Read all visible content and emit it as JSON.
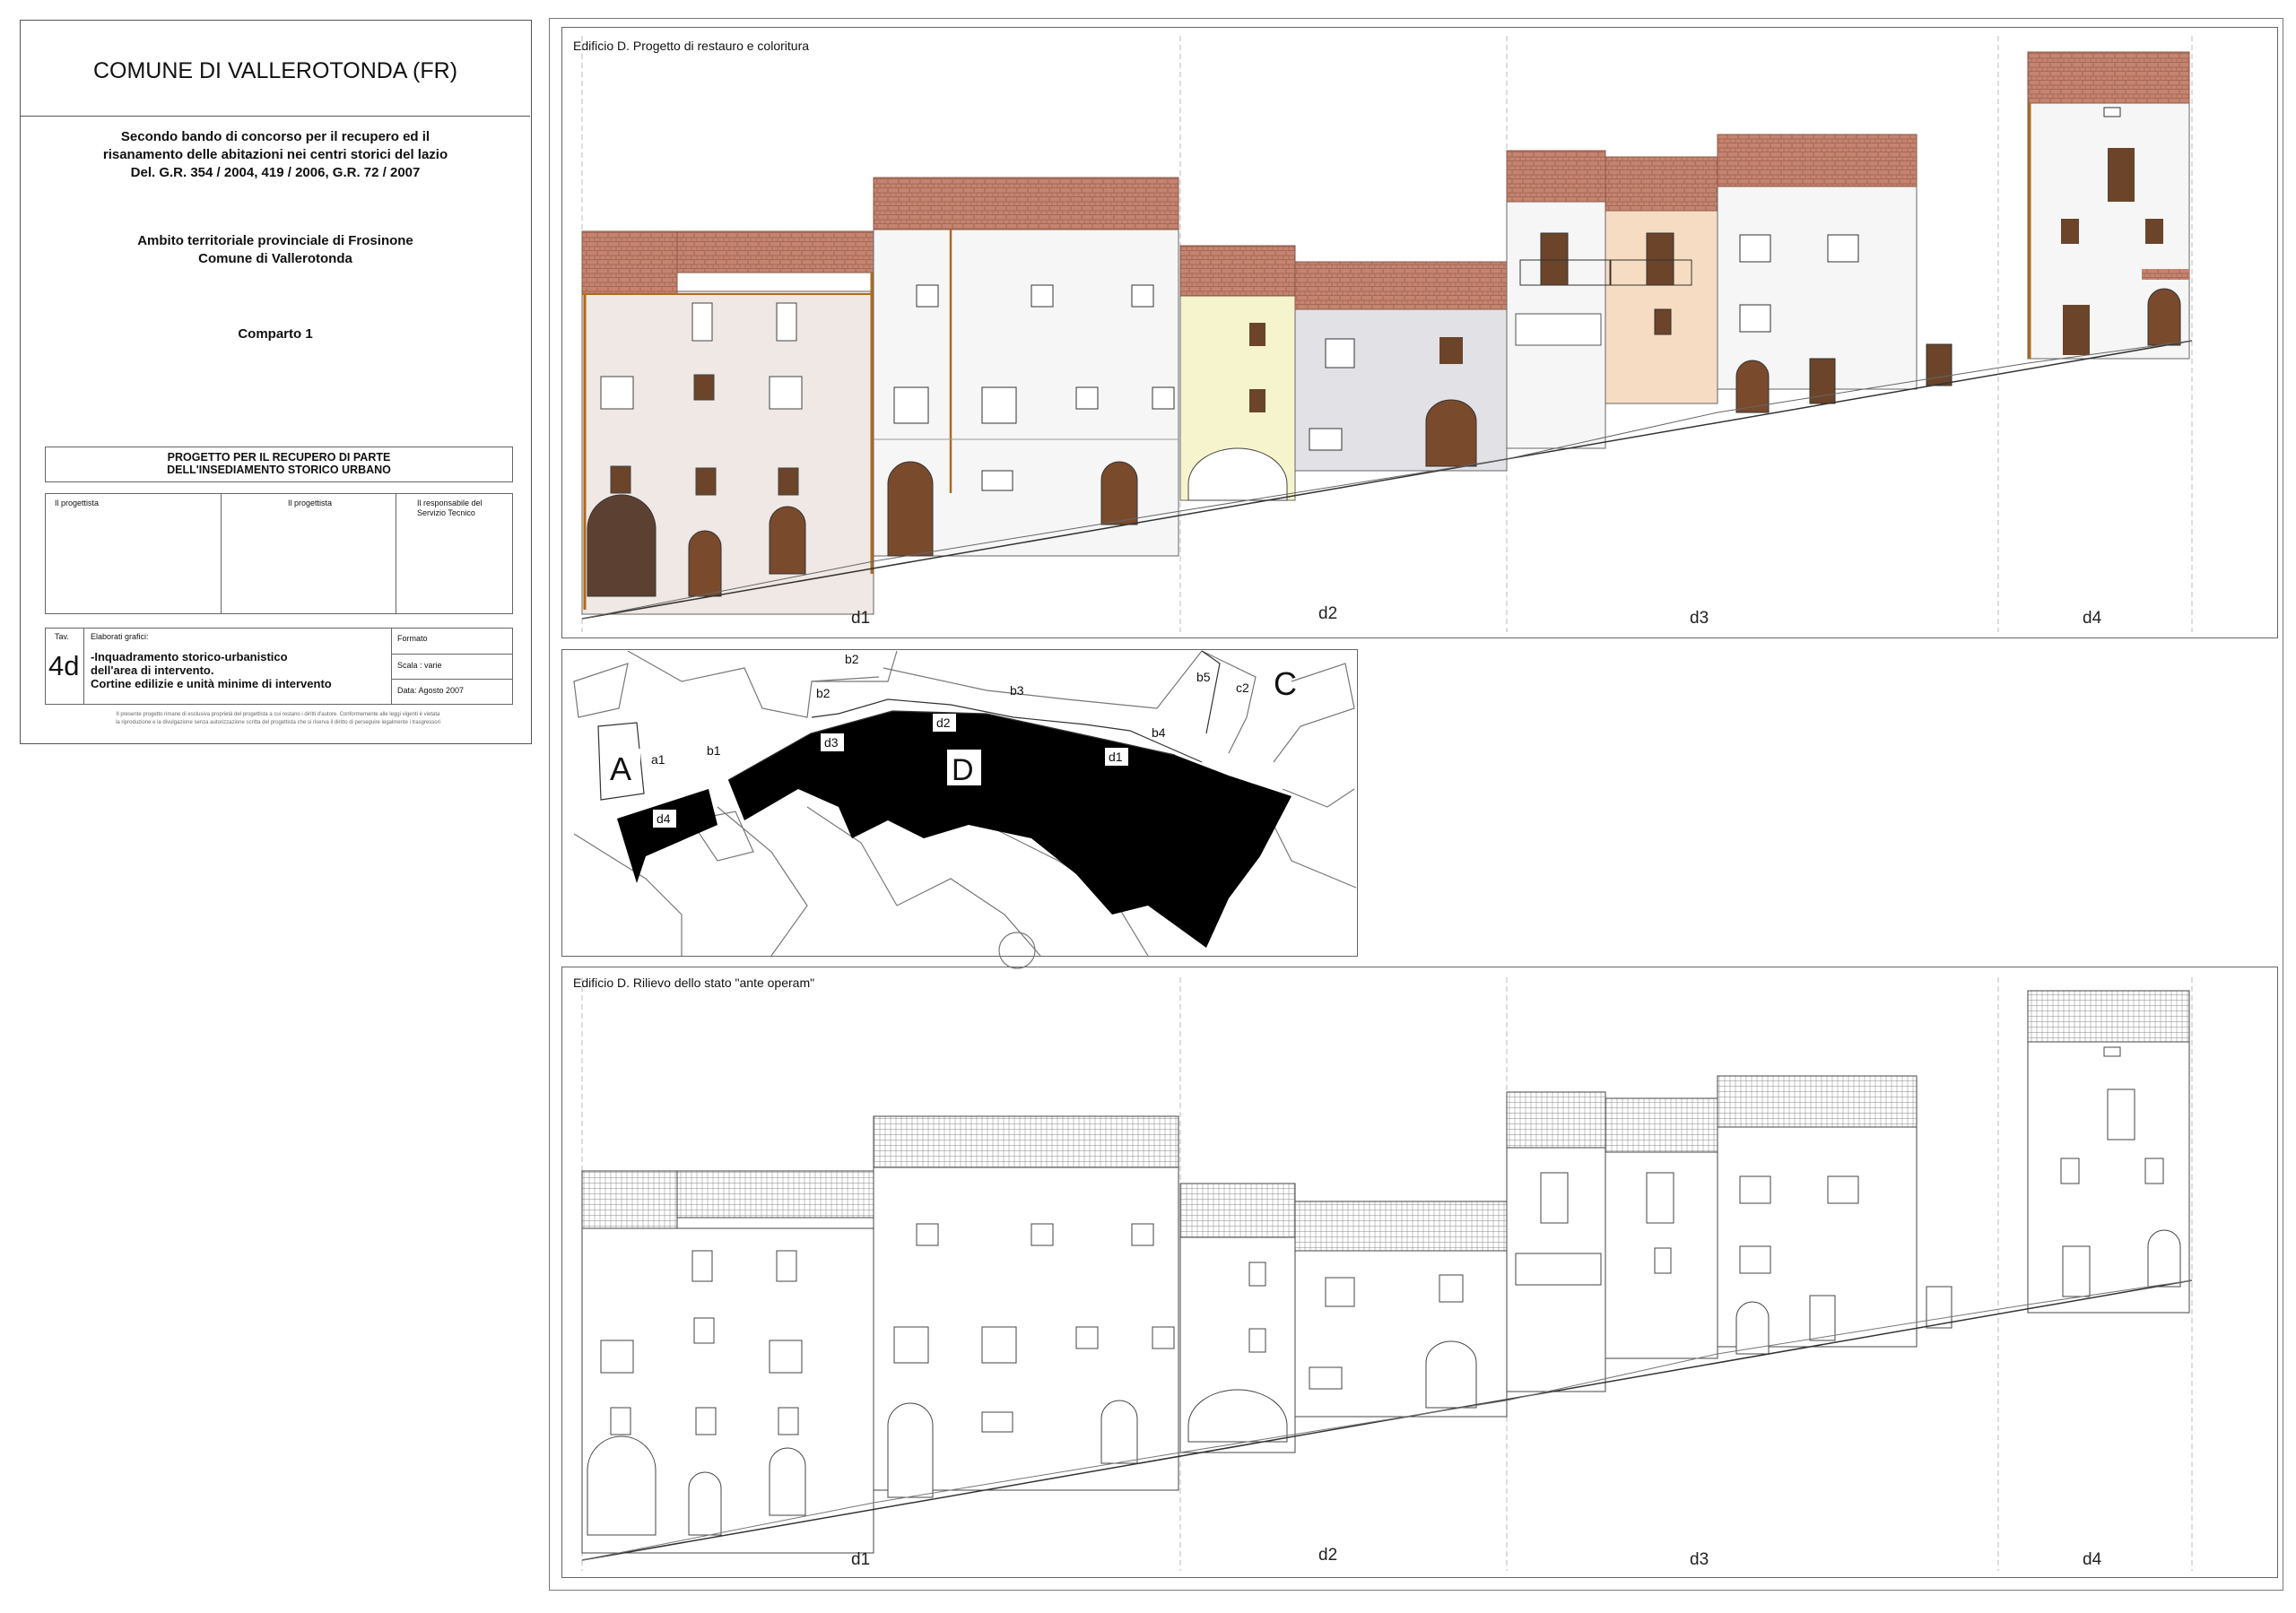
{
  "title_block": {
    "municipality": "COMUNE DI VALLEROTONDA  (FR)",
    "bando_line1": "Secondo bando di concorso per il recupero ed il",
    "bando_line2": "risanamento delle abitazioni nei centri storici del lazio",
    "bando_line3": "Del. G.R. 354 / 2004, 419 / 2006, G.R. 72 / 2007",
    "ambito_line1": "Ambito territoriale provinciale di Frosinone",
    "ambito_line2": "Comune di Vallerotonda",
    "comparto": "Comparto 1",
    "progetto_line1": "PROGETTO  PER IL RECUPERO DI PARTE",
    "progetto_line2": "DELL'INSEDIAMENTO STORICO URBANO",
    "sign_1": "Il progettista",
    "sign_2": "Il progettista",
    "sign_3_line1": "Il responsabile del",
    "sign_3_line2": "Servizio Tecnico",
    "tav_label": "Tav.",
    "tav_number": "4d",
    "elaborati_label": "Elaborati grafici:",
    "elaborati_line1": "-Inquadramento storico-urbanistico",
    "elaborati_line2": "dell'area di intervento.",
    "elaborati_line3": "Cortine edilizie e unità minime di intervento",
    "formato": "Formato",
    "scala": "Scala : varie",
    "data": "Data: Agosto 2007",
    "disclaimer_line1": "Il presente progetto rimane di esclusiva proprietà del progettista a cui restano i diritti d'autore. Conformemente alle leggi vigenti è vietata",
    "disclaimer_line2": "la riproduzione e la divulgazione senza autorizzazione scritta del progettista che si riserva il diritto di perseguire legalmente i trasgressori"
  },
  "elevation_top": {
    "caption": "Edificio D. Progetto di restauro e coloritura",
    "units": [
      "d1",
      "d2",
      "d3",
      "d4"
    ]
  },
  "plan": {
    "labels": [
      "A",
      "a1",
      "b1",
      "b2",
      "b2",
      "b3",
      "b4",
      "b5",
      "c2",
      "C",
      "D",
      "d1",
      "d2",
      "d3",
      "d4"
    ]
  },
  "elevation_bottom": {
    "caption": "Edificio D. Rilievo dello stato \"ante operam\"",
    "units": [
      "d1",
      "d2",
      "d3",
      "d4"
    ]
  },
  "colors": {
    "roof_tile": "#c48470",
    "roof_dark": "#a86a58",
    "wall_d1": "#efe8e4",
    "wall_white": "#f6f6f6",
    "wall_yellow": "#f6f4cc",
    "wall_grey": "#e2e2e6",
    "wall_peach": "#f6dcc2",
    "door_brown": "#7a4a2c",
    "gutter": "#b06a1a",
    "mass_black": "#000000"
  }
}
